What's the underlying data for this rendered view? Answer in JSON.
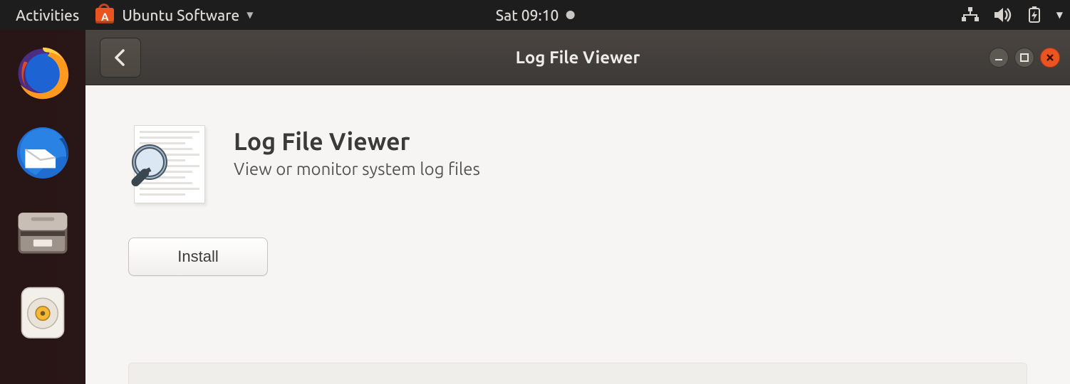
{
  "panel": {
    "activities": "Activities",
    "app_menu_label": "Ubuntu Software",
    "clock": "Sat 09:10"
  },
  "dock": {
    "items": [
      "firefox",
      "thunderbird",
      "files",
      "rhythmbox"
    ]
  },
  "window": {
    "title": "Log File Viewer"
  },
  "app": {
    "name": "Log File Viewer",
    "summary": "View or monitor system log files",
    "install_label": "Install"
  }
}
